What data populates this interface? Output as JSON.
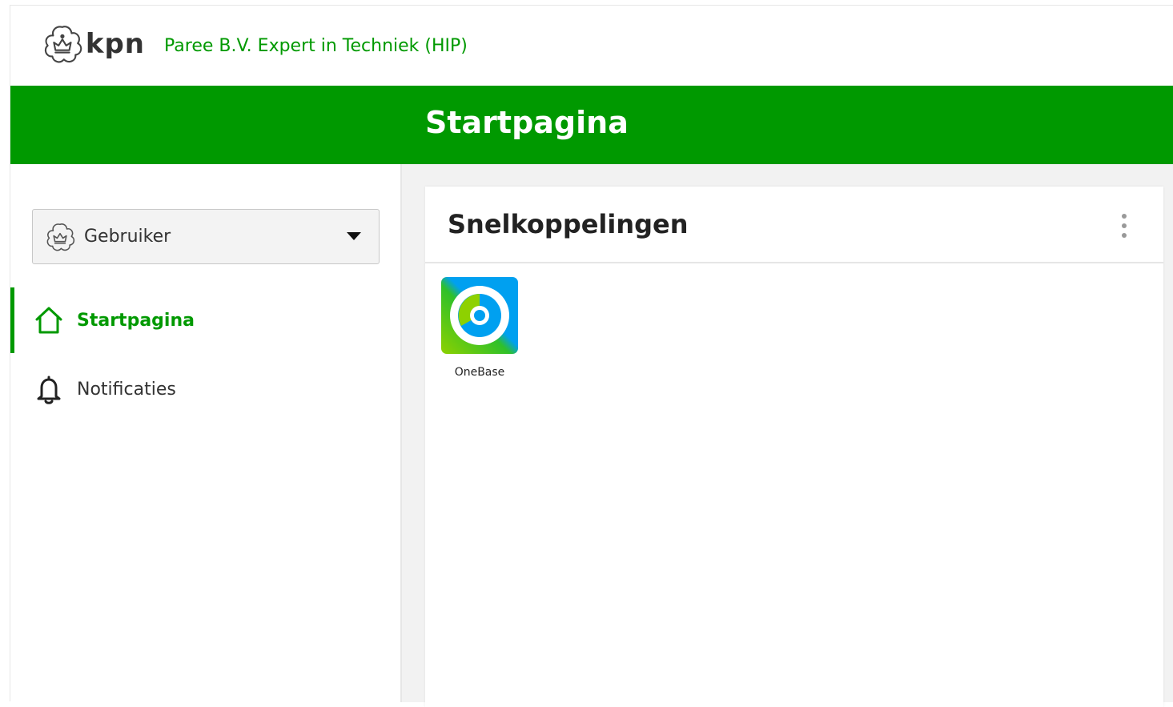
{
  "header": {
    "logo_text": "kpn",
    "company": "Paree B.V. Expert in Techniek (HIP)"
  },
  "title_bar": {
    "title": "Startpagina"
  },
  "sidebar": {
    "user_dropdown": {
      "label": "Gebruiker",
      "icon": "kpn-crown-icon"
    },
    "nav": [
      {
        "label": "Startpagina",
        "icon": "home-icon",
        "active": true
      },
      {
        "label": "Notificaties",
        "icon": "bell-icon",
        "active": false
      }
    ]
  },
  "main": {
    "card": {
      "title": "Snelkoppelingen",
      "menu_icon": "kebab-menu-icon",
      "shortcuts": [
        {
          "label": "OneBase",
          "icon": "onebase-app-icon"
        }
      ]
    }
  },
  "colors": {
    "brand_green": "#009900",
    "text": "#333333",
    "panel_bg": "#f2f2f2",
    "onebase_blue": "#00a0f0",
    "onebase_lime": "#8ed100"
  }
}
